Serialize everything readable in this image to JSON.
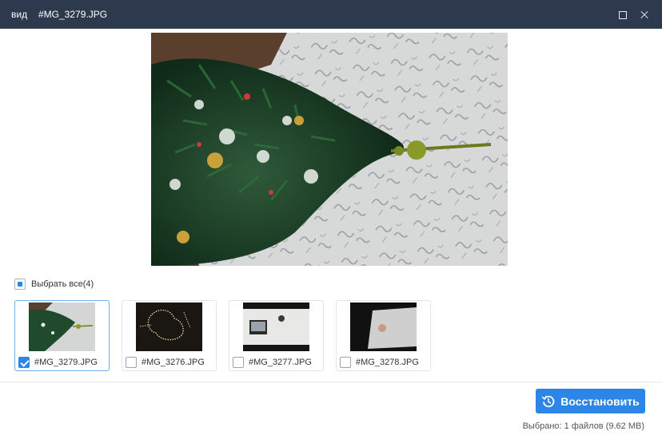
{
  "window": {
    "view_label": "вид",
    "title": "#MG_3279.JPG"
  },
  "icons": {
    "maximize": "maximize-icon",
    "close": "close-icon",
    "restore": "restore-history-icon"
  },
  "colors": {
    "titlebar": "#2d3a4e",
    "accent": "#2b86e8",
    "selected_border": "#6fb0ee"
  },
  "selection": {
    "select_all_label": "Выбрать все(4)"
  },
  "thumbnails": [
    {
      "name": "#MG_3279.JPG",
      "checked": true
    },
    {
      "name": "#MG_3276.JPG",
      "checked": false
    },
    {
      "name": "#MG_3277.JPG",
      "checked": false
    },
    {
      "name": "#MG_3278.JPG",
      "checked": false
    }
  ],
  "footer": {
    "restore_label": "Восстановить",
    "status": "Выбрано: 1 файлов  (9.62 MB)"
  }
}
